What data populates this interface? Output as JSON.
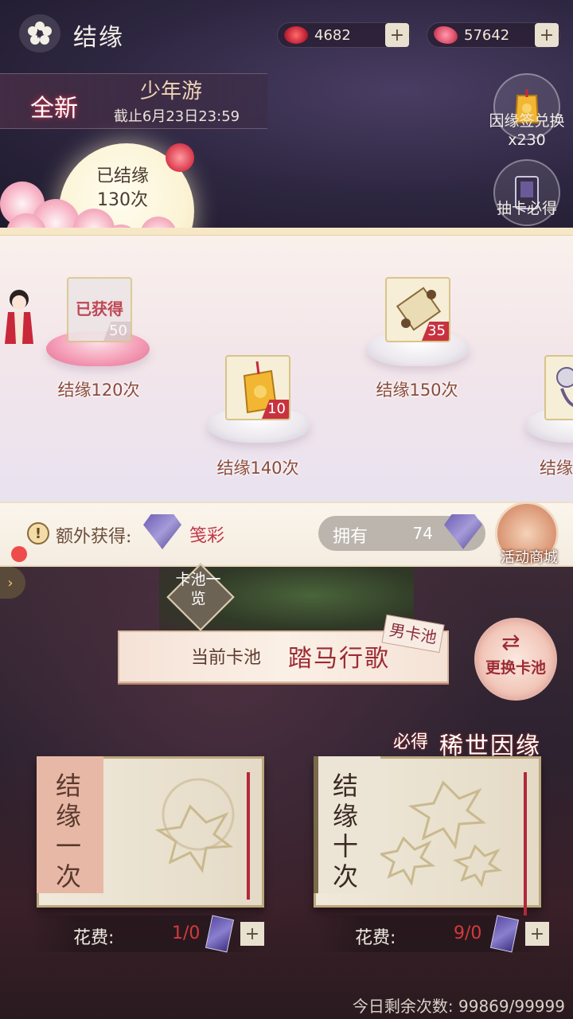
{
  "header": {
    "title": "结缘",
    "currencies": [
      {
        "name": "red-gem-icon",
        "value": "4682",
        "color": "#c8283a"
      },
      {
        "name": "butterfly-icon",
        "value": "57642",
        "color": "#e0506a"
      }
    ],
    "plus": "+"
  },
  "event": {
    "badge": "全新",
    "name": "少年游",
    "deadline": "截止6月23日23:59"
  },
  "side_buttons": {
    "redeem": {
      "label": "因缘签兑换",
      "count": "x230"
    },
    "guarantee": {
      "label": "抽卡必得"
    }
  },
  "progress": {
    "label": "已结缘",
    "count": "130次"
  },
  "rewards": [
    {
      "label": "结缘120次",
      "count": "50",
      "obtained_label": "已获得",
      "obtained": true
    },
    {
      "label": "结缘140次",
      "count": "10",
      "obtained": false
    },
    {
      "label": "结缘150次",
      "count": "35",
      "obtained": false
    },
    {
      "label": "结缘",
      "obtained": false
    }
  ],
  "extra": {
    "label": "额外获得:",
    "item": "笺彩",
    "own_label": "拥有",
    "own_value": "74",
    "shop_label": "活动商城"
  },
  "pool": {
    "list_label": "卡池一览",
    "prefix": "当前卡池",
    "name": "踏马行歌",
    "tag": "男卡池",
    "switch_label": "更换卡池",
    "switch_arrows": "⇄",
    "guarantee_prefix": "必得",
    "guarantee_name": "稀世因缘"
  },
  "draws": [
    {
      "title": "结缘一次",
      "cost_label": "花费:",
      "cost_value": "1/0"
    },
    {
      "title": "结缘十次",
      "cost_label": "花费:",
      "cost_value": "9/0"
    }
  ],
  "remaining": "今日剩余次数: 99869/99999",
  "icons": {
    "back": "cherry-blossom-back-icon",
    "warn": "!",
    "left_arrow": "›"
  },
  "colors": {
    "accent_red": "#9c2b34",
    "cost_red": "#d43a3a",
    "gold_border": "#d8c48a"
  }
}
